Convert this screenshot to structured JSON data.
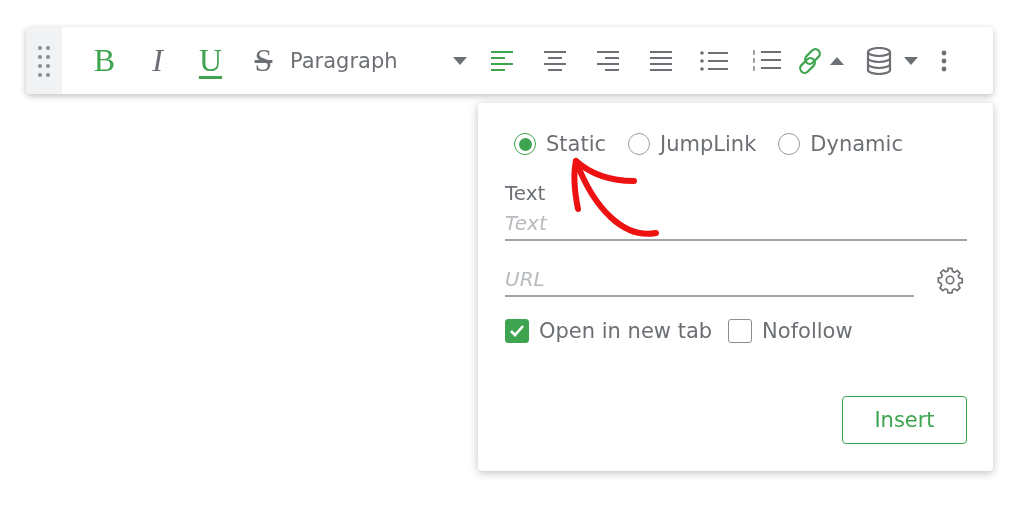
{
  "toolbar": {
    "format_buttons": [
      {
        "kind": "bold",
        "label": "B",
        "active": true
      },
      {
        "kind": "italic",
        "label": "I",
        "active": false
      },
      {
        "kind": "underline",
        "label": "U",
        "active": true
      },
      {
        "kind": "strike",
        "label": "S",
        "active": false
      }
    ],
    "block_format": {
      "value": "Paragraph"
    },
    "align_buttons": [
      {
        "kind": "left",
        "active": true
      },
      {
        "kind": "center",
        "active": false
      },
      {
        "kind": "right",
        "active": false
      },
      {
        "kind": "justify",
        "active": false
      }
    ],
    "list_buttons": [
      {
        "kind": "bullet"
      },
      {
        "kind": "numbered"
      }
    ],
    "link_button": {
      "active": true,
      "expanded": true
    },
    "data_button": {
      "active": false
    }
  },
  "link_popup": {
    "link_types": [
      {
        "label": "Static",
        "selected": true
      },
      {
        "label": "JumpLink",
        "selected": false
      },
      {
        "label": "Dynamic",
        "selected": false
      }
    ],
    "text_field": {
      "label": "Text",
      "placeholder": "Text"
    },
    "url_field": {
      "placeholder": "URL"
    },
    "options": [
      {
        "label": "Open in new tab",
        "checked": true
      },
      {
        "label": "Nofollow",
        "checked": false
      }
    ],
    "insert_button": "Insert"
  }
}
